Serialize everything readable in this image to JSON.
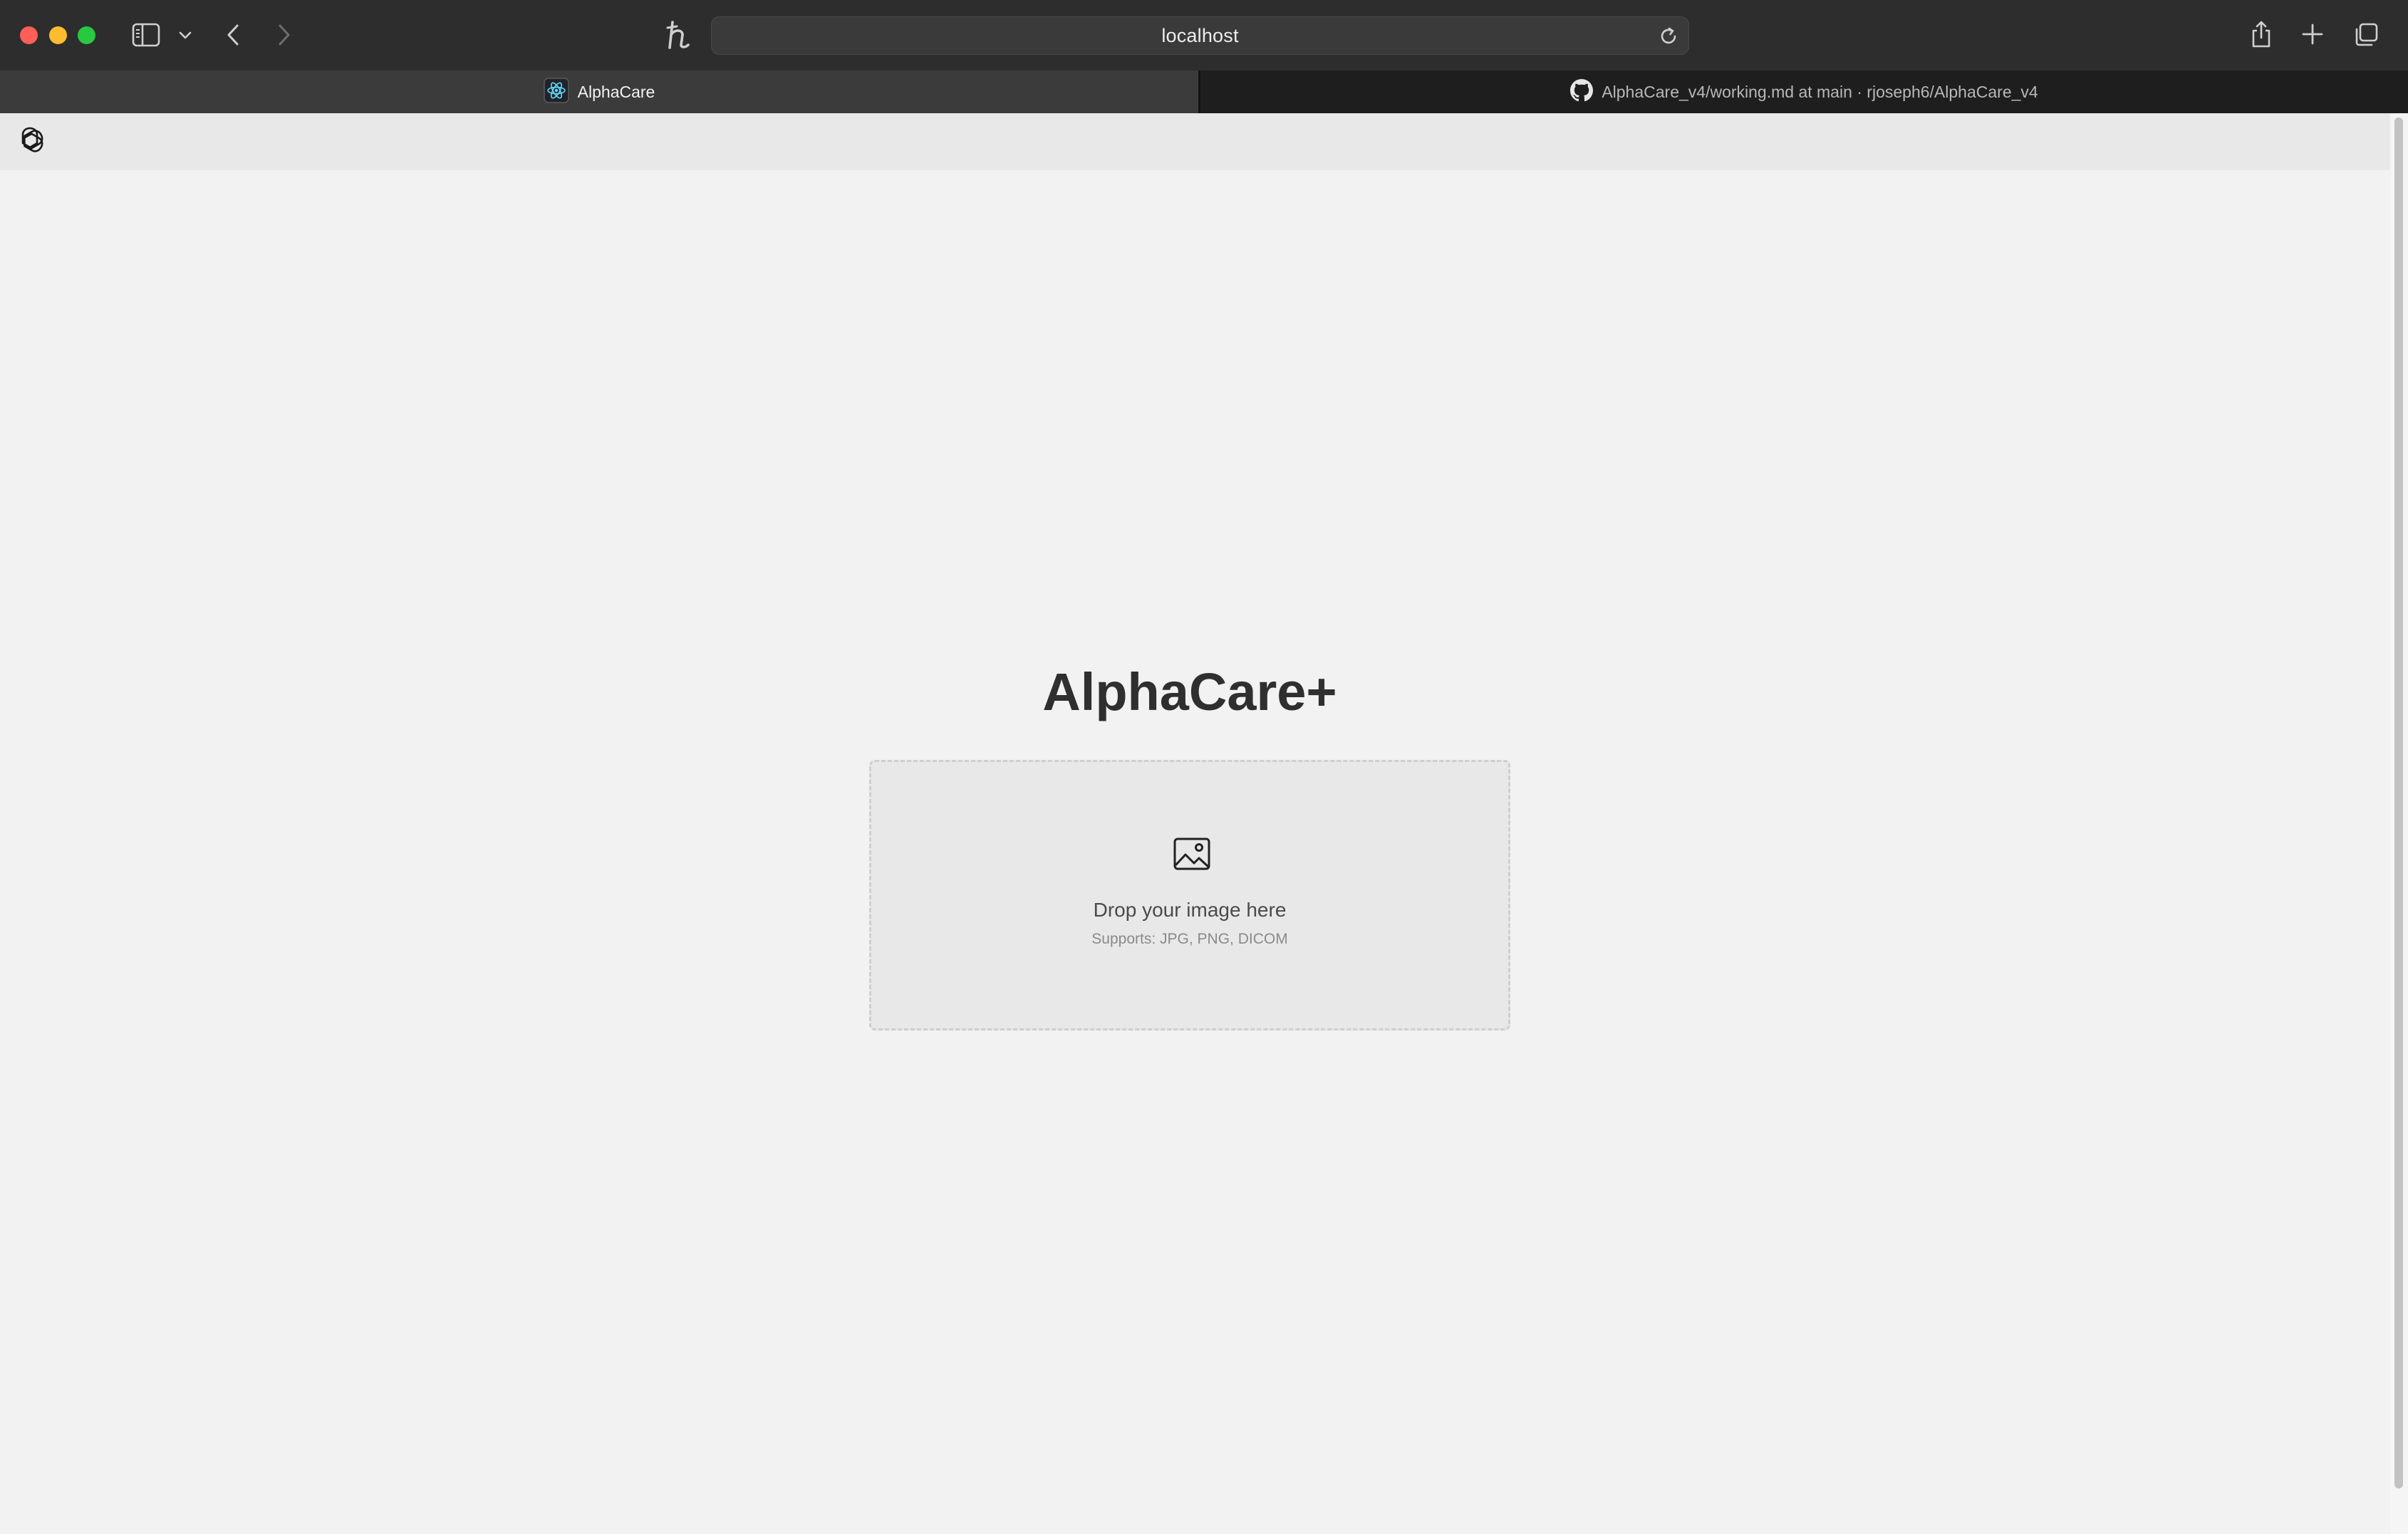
{
  "browser": {
    "url": "localhost",
    "colors": {
      "close": "#ff5f57",
      "minimize": "#febc2e",
      "zoom": "#28c840"
    },
    "tabs": [
      {
        "label": "AlphaCare",
        "icon": "react-icon",
        "active": true
      },
      {
        "label": "AlphaCare_v4/working.md at main · rjoseph6/AlphaCare_v4",
        "icon": "github-icon",
        "active": false
      }
    ]
  },
  "page": {
    "header_logo": "openai-logo-icon",
    "title": "AlphaCare+",
    "dropzone": {
      "icon": "image-icon",
      "title": "Drop your image here",
      "subtitle": "Supports: JPG, PNG, DICOM"
    }
  }
}
